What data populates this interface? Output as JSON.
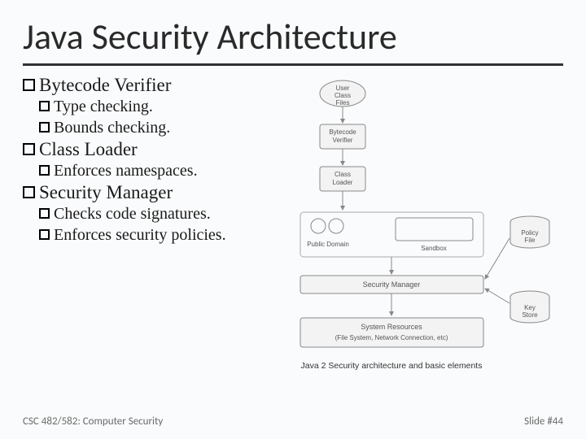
{
  "title": "Java Security Architecture",
  "sections": [
    {
      "heading": "Bytecode Verifier",
      "subs": [
        "Type checking.",
        "Bounds checking."
      ]
    },
    {
      "heading": "Class Loader",
      "subs": [
        "Enforces namespaces."
      ]
    },
    {
      "heading": "Security Manager",
      "subs": [
        "Checks code signatures.",
        "Enforces security policies."
      ]
    }
  ],
  "diagram": {
    "top_box": "User Class Files",
    "verifier": "Bytecode Verifier",
    "loader": "Class Loader",
    "public_domain": "Public Domain",
    "sandbox": "Sandbox",
    "security_manager": "Security Manager",
    "policy_file": "Policy File",
    "key_store": "Key Store",
    "system_resources": "System Resources",
    "system_resources_sub": "(File System, Network Connection, etc)",
    "caption": "Java 2 Security architecture and basic elements"
  },
  "footer": {
    "left": "CSC 482/582: Computer Security",
    "right": "Slide #44"
  }
}
